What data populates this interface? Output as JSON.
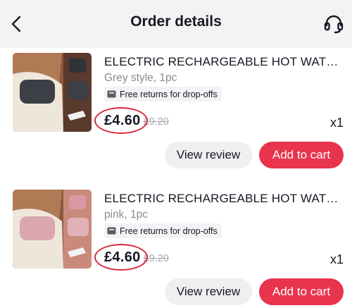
{
  "header": {
    "title": "Order details",
    "back_icon": "chevron-left-icon",
    "support_icon": "headset-icon"
  },
  "items": [
    {
      "name": "ELECTRIC RECHARGEABLE HOT WATER BOTTLE",
      "variant": "Grey style, 1pc",
      "returns": "Free returns for drop-offs",
      "price": "£4.60",
      "old_price": "£9.20",
      "quantity": "x1",
      "view_review": "View review",
      "add_to_cart": "Add to cart",
      "product_color": "#3c3f45"
    },
    {
      "name": "ELECTRIC RECHARGEABLE HOT WATER BOTTLE",
      "variant": "pink, 1pc",
      "returns": "Free returns for drop-offs",
      "price": "£4.60",
      "old_price": "£9.20",
      "quantity": "x1",
      "view_review": "View review",
      "add_to_cart": "Add to cart",
      "product_color": "#d9a7ad"
    }
  ],
  "colors": {
    "accent": "#e8344c",
    "annotation_circle": "#d8283a"
  }
}
